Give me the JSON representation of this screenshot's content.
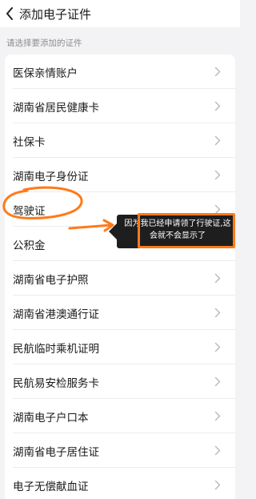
{
  "header": {
    "title": "添加电子证件",
    "back_icon": "chevron-left-icon"
  },
  "hint": "请选择要添加的证件",
  "items": [
    {
      "label": "医保亲情账户"
    },
    {
      "label": "湖南省居民健康卡"
    },
    {
      "label": "社保卡"
    },
    {
      "label": "湖南电子身份证"
    },
    {
      "label": "驾驶证"
    },
    {
      "label": "公积金"
    },
    {
      "label": "湖南省电子护照"
    },
    {
      "label": "湖南省港澳通行证"
    },
    {
      "label": "民航临时乘机证明"
    },
    {
      "label": "民航易安检服务卡"
    },
    {
      "label": "湖南电子户口本"
    },
    {
      "label": "湖南省电子居住证"
    },
    {
      "label": "电子无偿献血证"
    }
  ],
  "annotation": {
    "tooltip_text": "因为我已经申请领了行驶证,这会就不会显示了",
    "color": "#ff7a1a"
  }
}
